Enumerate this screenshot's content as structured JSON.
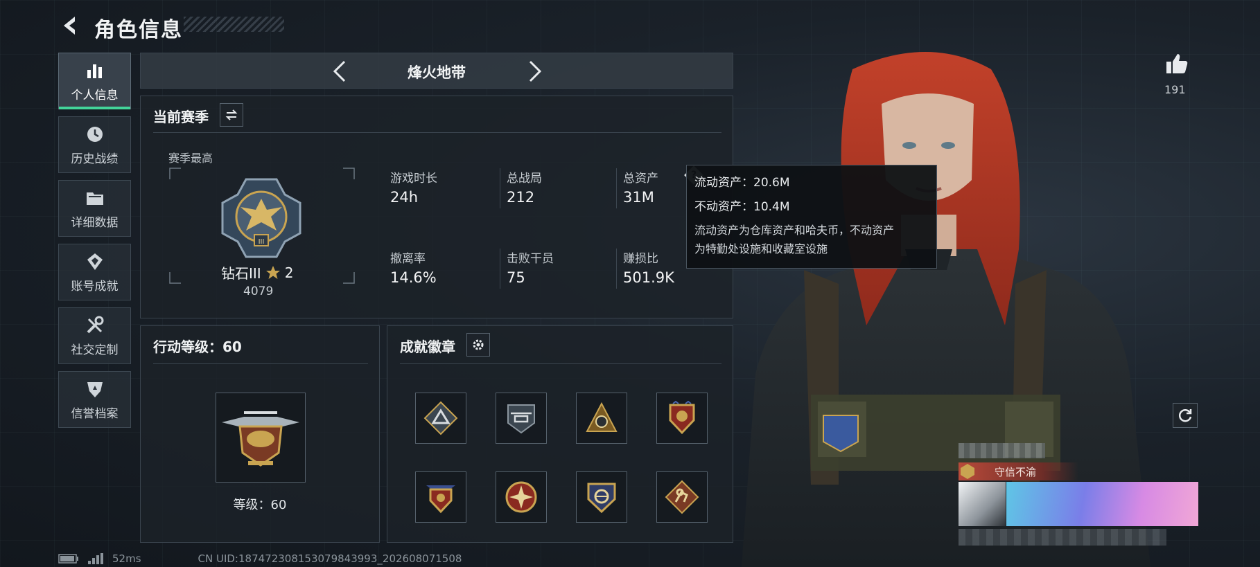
{
  "header": {
    "title": "角色信息"
  },
  "nav": [
    {
      "label": "个人信息",
      "icon": "bar-chart-icon",
      "active": true
    },
    {
      "label": "历史战绩",
      "icon": "clock-icon",
      "active": false
    },
    {
      "label": "详细数据",
      "icon": "folder-icon",
      "active": false
    },
    {
      "label": "账号成就",
      "icon": "achievement-icon",
      "active": false
    },
    {
      "label": "社交定制",
      "icon": "tools-icon",
      "active": false
    },
    {
      "label": "信誉档案",
      "icon": "shield-badge-icon",
      "active": false
    }
  ],
  "mode": {
    "name": "烽火地带"
  },
  "season": {
    "title": "当前赛季",
    "best_label": "赛季最高",
    "rank_name": "钻石III",
    "rank_stars": "2",
    "rank_score": "4079",
    "stats": [
      {
        "label": "游戏时长",
        "value": "24h"
      },
      {
        "label": "总战局",
        "value": "212"
      },
      {
        "label": "总资产",
        "value": "31M"
      },
      {
        "label": "撤离率",
        "value": "14.6%"
      },
      {
        "label": "击败干员",
        "value": "75"
      },
      {
        "label": "赚损比",
        "value": "501.9K"
      }
    ]
  },
  "tooltip": {
    "liquid": "流动资产：20.6M",
    "fixed": "不动资产：10.4M",
    "desc_1": "流动资产为仓库资产和哈夫币，不动资产",
    "desc_2": "为特勤处设施和收藏室设施"
  },
  "action_level": {
    "title": "行动等级：60",
    "level_label": "等级：60"
  },
  "badges": {
    "title": "成就徽章",
    "items": [
      "triangle-badge",
      "helicopter-badge",
      "pyramid-badge",
      "crest-badge",
      "shield-star-badge",
      "compass-badge",
      "emblem-badge",
      "soldier-badge"
    ]
  },
  "profile": {
    "likes": "191",
    "credit_title": "守信不渝"
  },
  "status_bar": {
    "ping": "52ms",
    "uid": "CN UID:1874723081530798439​93_202608071508"
  },
  "colors": {
    "accent": "#43d49a",
    "gold": "#c9a451",
    "credit_red": "#a33a3a"
  }
}
